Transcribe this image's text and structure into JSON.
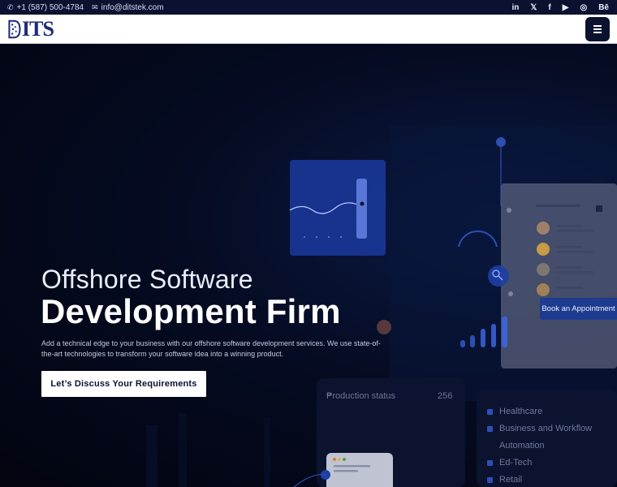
{
  "topbar": {
    "phone": "+1 (587) 500-4784",
    "email": "info@ditstek.com",
    "social": [
      "in",
      "𝕏",
      "f",
      "▶",
      "◎",
      "Bē"
    ]
  },
  "brand": {
    "logo_text": "ITS"
  },
  "hero": {
    "subtitle": "Offshore Software",
    "title": "Development Firm",
    "description": "Add a technical edge to your business with our offshore software development services. We use state-of-the-art technologies to transform your software idea into a winning product.",
    "cta_label": "Let’s Discuss Your Requirements"
  },
  "book_appointment_label": "Book an Appointment",
  "dashboard": {
    "production_label": "Production status",
    "production_value": "256",
    "industries": [
      "Healthcare",
      "Business and Workflow",
      "Automation",
      "Ed-Tech",
      "Retail"
    ]
  },
  "colors": {
    "topbar_bg": "#0b1230",
    "accent_blue": "#1d3b8f",
    "brand_navy": "#1c2b7a"
  }
}
